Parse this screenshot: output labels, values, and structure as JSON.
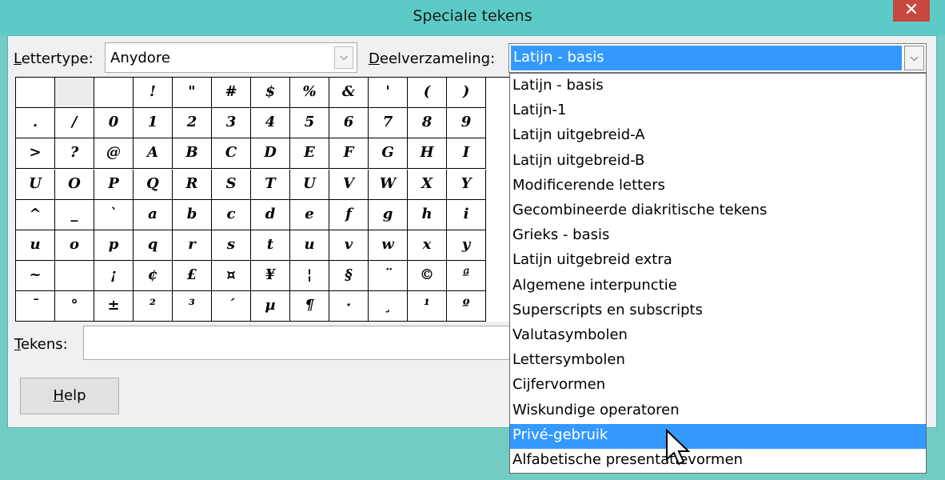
{
  "window": {
    "title": "Speciale tekens",
    "close_glyph": "✕"
  },
  "font": {
    "label": "Lettertype:",
    "label_underline": "L",
    "label_rest": "ettertype:",
    "value": "Anydore",
    "arrow": "⌵"
  },
  "subset": {
    "label_underline": "D",
    "label_rest": "eelverzameling:",
    "value": "Latijn - basis",
    "arrow": "⌵"
  },
  "grid": {
    "rows": [
      [
        "",
        "",
        "",
        "!",
        "\"",
        "#",
        "$",
        "%",
        "&",
        "'",
        "(",
        ")"
      ],
      [
        ".",
        "/",
        "0",
        "1",
        "2",
        "3",
        "4",
        "5",
        "6",
        "7",
        "8",
        "9"
      ],
      [
        ">",
        "?",
        "@",
        "A",
        "B",
        "C",
        "D",
        "E",
        "F",
        "G",
        "H",
        "I"
      ],
      [
        "U",
        "O",
        "P",
        "Q",
        "R",
        "S",
        "T",
        "U",
        "V",
        "W",
        "X",
        "Y"
      ],
      [
        "^",
        "_",
        "`",
        "a",
        "b",
        "c",
        "d",
        "e",
        "f",
        "g",
        "h",
        "i"
      ],
      [
        "u",
        "o",
        "p",
        "q",
        "r",
        "s",
        "t",
        "u",
        "v",
        "w",
        "x",
        "y"
      ],
      [
        "~",
        "",
        "¡",
        "¢",
        "£",
        "¤",
        "¥",
        "¦",
        "§",
        "¨",
        "©",
        "ª"
      ],
      [
        "¯",
        "°",
        "±",
        "²",
        "³",
        "´",
        "µ",
        "¶",
        "·",
        "¸",
        "¹",
        "º"
      ]
    ]
  },
  "tekens": {
    "label_underline": "T",
    "label_rest": "ekens:",
    "value": ""
  },
  "help": {
    "label_underline": "H",
    "label_rest": "elp"
  },
  "dropdown": {
    "items": [
      "Latijn - basis",
      "Latijn-1",
      "Latijn uitgebreid-A",
      "Latijn uitgebreid-B",
      "Modificerende letters",
      "Gecombineerde diakritische tekens",
      "Grieks - basis",
      "Latijn uitgebreid extra",
      "Algemene interpunctie",
      "Superscripts en subscripts",
      "Valutasymbolen",
      "Lettersymbolen",
      "Cijfervormen",
      "Wiskundige operatoren",
      "Privé-gebruik",
      "Alfabetische presentatievormen"
    ],
    "highlighted_index": 14
  },
  "colors": {
    "accent": "#3399ff",
    "close": "#c7483f",
    "titlebar": "#5ccbc8"
  }
}
